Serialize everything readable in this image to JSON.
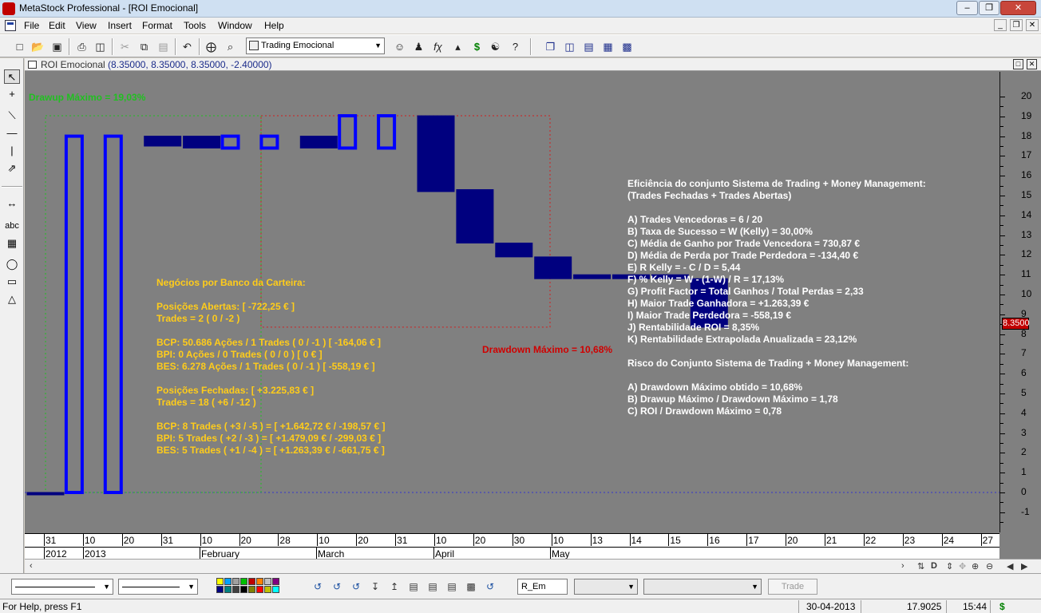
{
  "window": {
    "title": "MetaStock Professional - [ROI Emocional]"
  },
  "menu": {
    "items": [
      "File",
      "Edit",
      "View",
      "Insert",
      "Format",
      "Tools",
      "Window",
      "Help"
    ]
  },
  "toolbar": {
    "system_select": "Trading Emocional"
  },
  "chart_header": {
    "name": "ROI Emocional",
    "values": "(8.35000, 8.35000, 8.35000, -2.40000)"
  },
  "yaxis": {
    "labels": [
      "20",
      "19",
      "18",
      "17",
      "16",
      "15",
      "14",
      "13",
      "12",
      "11",
      "10",
      "9",
      "8",
      "7",
      "6",
      "5",
      "4",
      "3",
      "2",
      "1",
      "0",
      "-1"
    ],
    "last_price": "8.3500"
  },
  "xaxis": {
    "day_labels": [
      "31",
      "10",
      "20",
      "31",
      "10",
      "20",
      "28",
      "10",
      "20",
      "31",
      "10",
      "20",
      "30",
      "10",
      "13",
      "14",
      "15",
      "16",
      "17",
      "20",
      "21",
      "22",
      "23",
      "24",
      "27"
    ],
    "period_labels": [
      "2012",
      "2013",
      "February",
      "March",
      "April",
      "May"
    ]
  },
  "annotations": {
    "drawup": "Drawup Máximo = 19,03%",
    "drawdown": "Drawdown Máximo = 10,68%",
    "portfolio": [
      "Negócios por Banco da Carteira:",
      "",
      "Posições Abertas: [ -722,25 € ]",
      "Trades = 2 ( 0 / -2 )",
      "",
      "BCP: 50.686 Ações / 1 Trades ( 0 / -1 ) [ -164,06 € ]",
      "BPI: 0 Ações / 0 Trades ( 0 / 0 ) [ 0 € ]",
      "BES: 6.278 Ações / 1 Trades ( 0 / -1 ) [ -558,19 € ]",
      "",
      "Posições Fechadas: [ +3.225,83 € ]",
      "Trades = 18 ( +6 / -12 )",
      "",
      "BCP: 8 Trades ( +3 / -5 ) = [ +1.642,72 € / -198,57 € ]",
      "BPI: 5 Trades ( +2 / -3 ) = [ +1.479,09 € / -299,03 € ]",
      "BES: 5 Trades ( +1 / -4 ) = [ +1.263,39 € / -661,75 € ]"
    ],
    "efficiency": [
      "Eficiência do conjunto Sistema de Trading + Money Management:",
      "(Trades Fechadas + Trades Abertas)",
      "",
      "A) Trades Vencedoras = 6 / 20",
      "B) Taxa de Sucesso = W (Kelly) = 30,00%",
      "C) Média de Ganho por Trade Vencedora = 730,87 €",
      "D) Média de Perda por Trade Perdedora = -134,40 €",
      "E) R Kelly = - C / D = 5,44",
      "F) % Kelly = W - (1-W) / R = 17,13%",
      "G) Profit Factor = Total Ganhos / Total Perdas = 2,33",
      "H) Maior Trade Ganhadora = +1.263,39 €",
      "I) Maior Trade Perdedora = -558,19 €",
      "J) Rentabilidade ROI = 8,35%",
      "K) Rentabilidade Extrapolada Anualizada = 23,12%",
      "",
      "Risco do Conjunto Sistema de Trading + Money Management:",
      "",
      "A) Drawdown Máximo obtido = 10,68%",
      "B) Drawup Máximo / Drawdown Máximo = 1,78",
      "C) ROI / Drawdown Máximo = 0,78"
    ]
  },
  "chart_data": {
    "type": "candlestick",
    "ylim": [
      -1.5,
      20.5
    ],
    "bars": [
      {
        "open": 0.0,
        "close": 0.0
      },
      {
        "open": 0.0,
        "close": 18.0
      },
      {
        "open": 0.0,
        "close": 18.0
      },
      {
        "open": 18.0,
        "close": 17.5
      },
      {
        "open": 18.0,
        "close": 17.4
      },
      {
        "open": 17.4,
        "close": 18.0
      },
      {
        "open": 17.4,
        "close": 18.0
      },
      {
        "open": 18.0,
        "close": 17.4
      },
      {
        "open": 17.4,
        "close": 19.03
      },
      {
        "open": 17.4,
        "close": 19.03
      },
      {
        "open": 19.03,
        "close": 15.2
      },
      {
        "open": 15.3,
        "close": 12.6
      },
      {
        "open": 12.6,
        "close": 11.9
      },
      {
        "open": 11.9,
        "close": 10.8
      },
      {
        "open": 11.0,
        "close": 10.8
      },
      {
        "open": 11.0,
        "close": 10.8
      },
      {
        "open": 11.0,
        "close": 10.8
      },
      {
        "open": 10.8,
        "close": 8.35
      }
    ],
    "reference_lines": {
      "drawup_level": 19.03,
      "zero_level": 0.0
    }
  },
  "statusbar": {
    "help": "For Help, press F1",
    "date": "30-04-2013",
    "value": "17.9025",
    "time": "15:44"
  },
  "bottombar": {
    "symbol": "R_Em",
    "trade_label": "Trade"
  },
  "colors": {
    "chart_bg": "#808080",
    "bar": "#00007f",
    "bar_outline": "#0000ff",
    "yellow_text": "#ffcc1a",
    "red_text": "#d00000",
    "green_text": "#20c020"
  }
}
